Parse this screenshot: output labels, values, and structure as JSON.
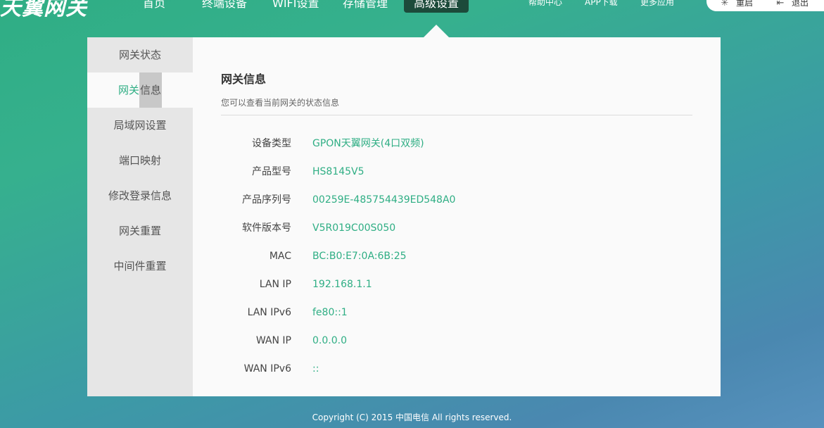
{
  "header": {
    "logo": "天翼网关",
    "nav": [
      "首页",
      "终端设备",
      "WIFI设置",
      "存储管理",
      "高级设置"
    ],
    "active_nav": "高级设置",
    "links": [
      "帮助中心",
      "APP下载",
      "更多应用"
    ],
    "tools": [
      {
        "label": "重启",
        "icon": "restart-icon"
      },
      {
        "label": "退出",
        "icon": "logout-icon"
      }
    ]
  },
  "sidebar": {
    "items": [
      {
        "label": "网关状态"
      },
      {
        "label_a": "网关",
        "label_b": "信息"
      },
      {
        "label": "局域网设置"
      },
      {
        "label": "端口映射"
      },
      {
        "label": "修改登录信息"
      },
      {
        "label": "网关重置"
      },
      {
        "label": "中间件重置"
      }
    ]
  },
  "main": {
    "title": "网关信息",
    "description": "您可以查看当前网关的状态信息",
    "rows": [
      {
        "label": "设备类型",
        "value": "GPON天翼网关(4口双频)"
      },
      {
        "label": "产品型号",
        "value": "HS8145V5"
      },
      {
        "label": "产品序列号",
        "value": "00259E-485754439ED548A0"
      },
      {
        "label": "软件版本号",
        "value": "V5R019C00S050"
      },
      {
        "label": "MAC",
        "value": "BC:B0:E7:0A:6B:25"
      },
      {
        "label": "LAN IP",
        "value": "192.168.1.1"
      },
      {
        "label": "LAN IPv6",
        "value": "fe80::1"
      },
      {
        "label": "WAN IP",
        "value": "0.0.0.0"
      },
      {
        "label": "WAN IPv6",
        "value": "::"
      }
    ]
  },
  "footer": {
    "copyright": "Copyright (C) 2015 中国电信 All rights reserved."
  },
  "colors": {
    "accent": "#2fae84",
    "nav_active": "#1c4a3a"
  }
}
